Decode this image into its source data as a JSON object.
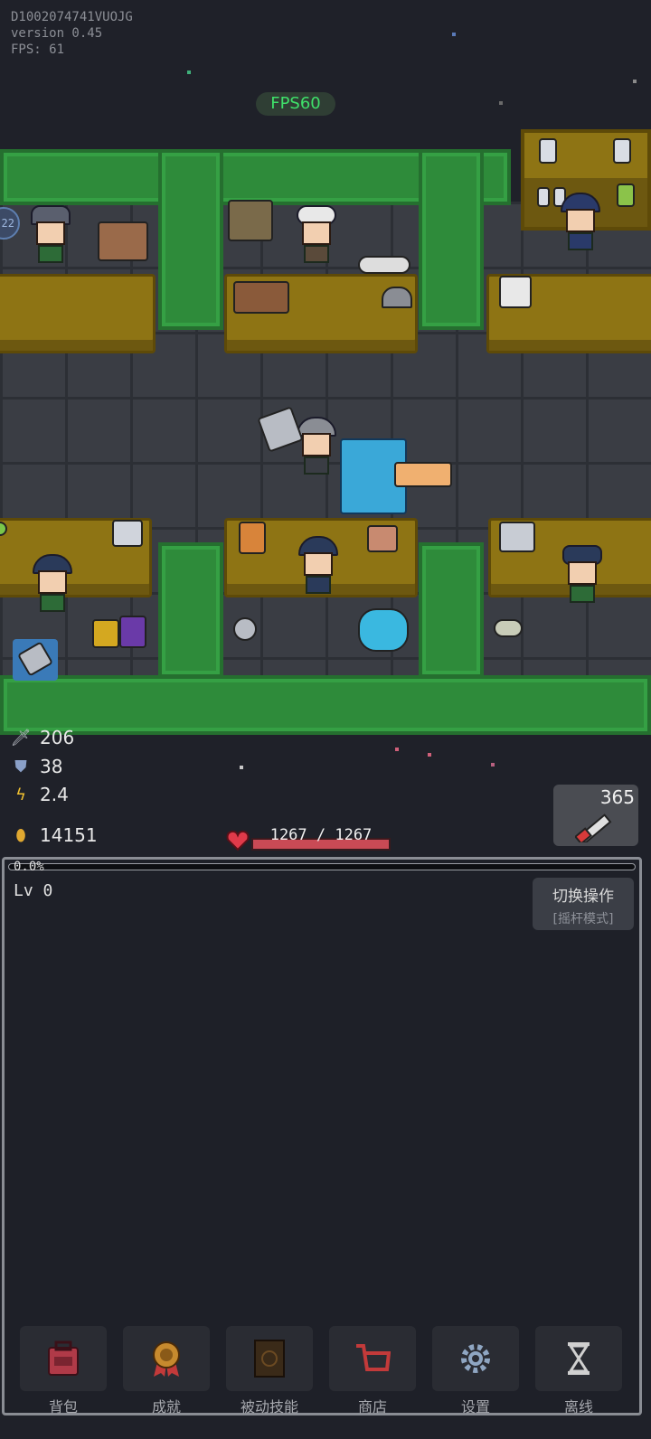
{
  "debug": {
    "device_id": "D1002074741VUOJG",
    "version": "version 0.45",
    "fps": "FPS: 61"
  },
  "fps_badge": "FPS60",
  "room_level_badge": "22",
  "stats": {
    "attack": "206",
    "defense": "38",
    "speed": "2.4",
    "gold": "14151",
    "attack_icon": "sword-icon",
    "defense_icon": "shield-icon",
    "speed_icon": "lightning-icon",
    "gold_icon": "coin-icon"
  },
  "potion": {
    "count": "365",
    "icon": "potion-icon"
  },
  "hp": {
    "text": "1267 / 1267",
    "current": 1267,
    "max": 1267,
    "icon": "heart-icon"
  },
  "panel": {
    "xp_percent": "0.0%",
    "xp_fraction": 0.0,
    "level": "Lv 0",
    "switch_label": "切换操作",
    "switch_mode": "[摇杆模式]"
  },
  "nav": [
    {
      "label": "背包",
      "icon": "backpack-icon",
      "color": "#b03a48"
    },
    {
      "label": "成就",
      "icon": "medal-icon",
      "color": "#c78a2e"
    },
    {
      "label": "被动技能",
      "icon": "skill-book-icon",
      "color": "#6b4a22"
    },
    {
      "label": "商店",
      "icon": "shop-cart-icon",
      "color": "#c23a3a"
    },
    {
      "label": "设置",
      "icon": "gear-icon",
      "color": "#8fa6c2"
    },
    {
      "label": "离线",
      "icon": "hourglass-icon",
      "color": "#d0d0d0"
    }
  ],
  "colors": {
    "hedge": "#2e8b3a",
    "counter": "#8e7414",
    "floor": "#3a3d44",
    "fps_green": "#3fe06a",
    "hp_red": "#c94a55"
  }
}
